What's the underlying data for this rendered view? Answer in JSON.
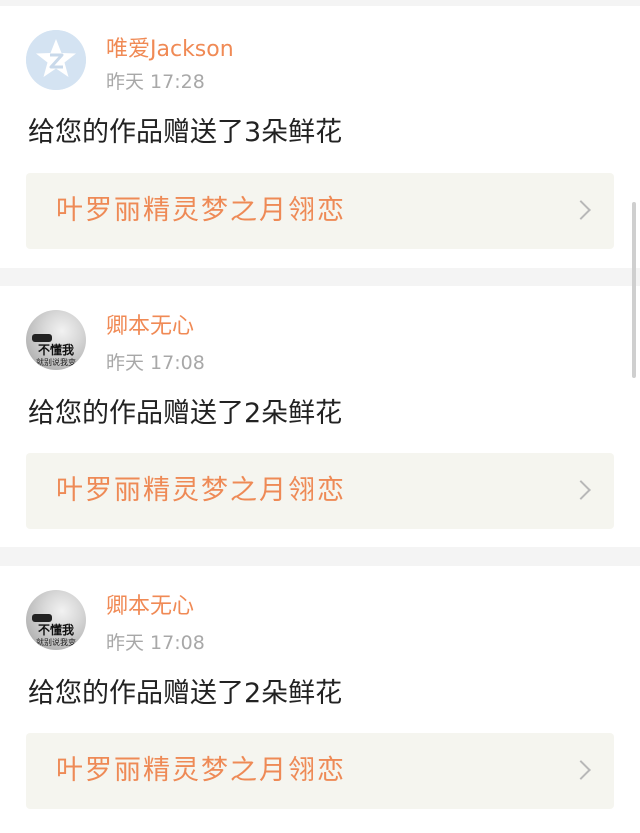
{
  "notifications": [
    {
      "username": "唯爱Jackson",
      "time": "昨天 17:28",
      "message": "给您的作品赠送了3朵鲜花",
      "work_title": "叶罗丽精灵梦之月翎恋",
      "avatar": "z-logo"
    },
    {
      "username": "卿本无心",
      "time": "昨天 17:08",
      "message": "给您的作品赠送了2朵鲜花",
      "work_title": "叶罗丽精灵梦之月翎恋",
      "avatar": "photo",
      "avatar_caption": "不懂我",
      "avatar_subcaption": "就别说我变"
    },
    {
      "username": "卿本无心",
      "time": "昨天 17:08",
      "message": "给您的作品赠送了2朵鲜花",
      "work_title": "叶罗丽精灵梦之月翎恋",
      "avatar": "photo",
      "avatar_caption": "不懂我",
      "avatar_subcaption": "就别说我变"
    }
  ],
  "colors": {
    "username": "#f08a55",
    "work_title": "#ee8a56",
    "timestamp": "#a8a8a8",
    "message": "#222222",
    "link_background": "#f5f5ef",
    "page_background": "#f4f4f4"
  }
}
